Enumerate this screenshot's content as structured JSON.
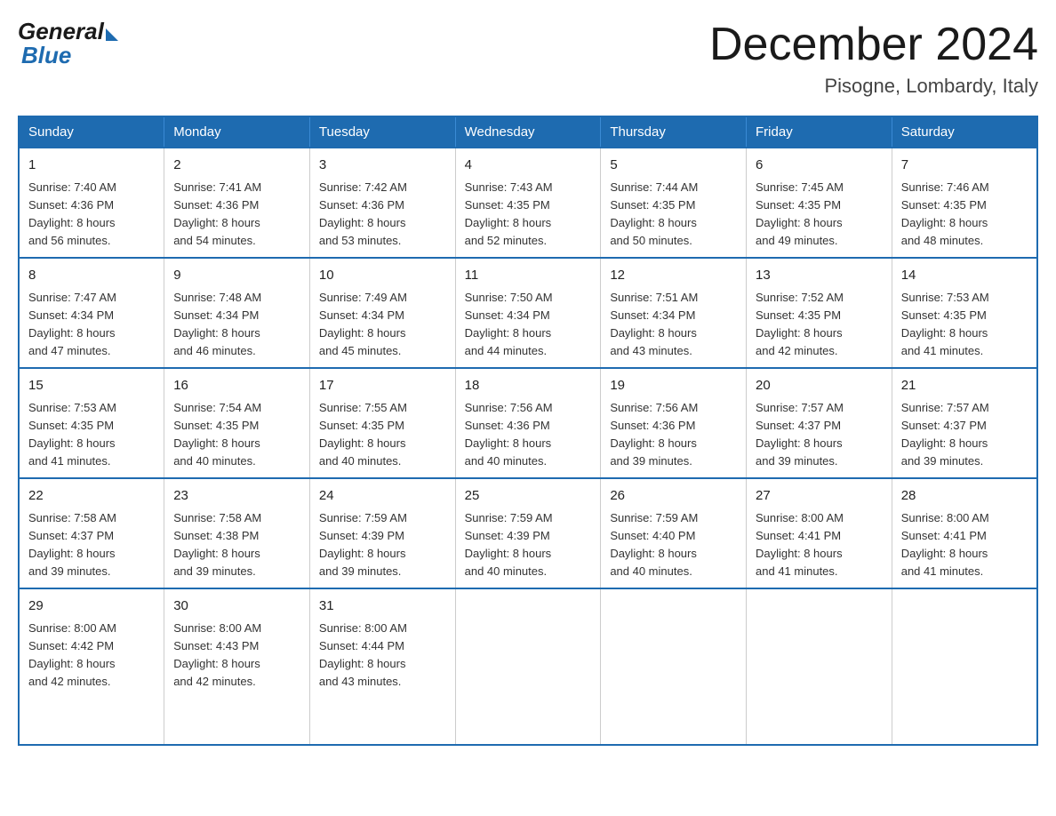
{
  "logo": {
    "general": "General",
    "blue": "Blue"
  },
  "title": "December 2024",
  "location": "Pisogne, Lombardy, Italy",
  "days_of_week": [
    "Sunday",
    "Monday",
    "Tuesday",
    "Wednesday",
    "Thursday",
    "Friday",
    "Saturday"
  ],
  "weeks": [
    [
      {
        "day": "1",
        "sunrise": "7:40 AM",
        "sunset": "4:36 PM",
        "daylight": "8 hours and 56 minutes."
      },
      {
        "day": "2",
        "sunrise": "7:41 AM",
        "sunset": "4:36 PM",
        "daylight": "8 hours and 54 minutes."
      },
      {
        "day": "3",
        "sunrise": "7:42 AM",
        "sunset": "4:36 PM",
        "daylight": "8 hours and 53 minutes."
      },
      {
        "day": "4",
        "sunrise": "7:43 AM",
        "sunset": "4:35 PM",
        "daylight": "8 hours and 52 minutes."
      },
      {
        "day": "5",
        "sunrise": "7:44 AM",
        "sunset": "4:35 PM",
        "daylight": "8 hours and 50 minutes."
      },
      {
        "day": "6",
        "sunrise": "7:45 AM",
        "sunset": "4:35 PM",
        "daylight": "8 hours and 49 minutes."
      },
      {
        "day": "7",
        "sunrise": "7:46 AM",
        "sunset": "4:35 PM",
        "daylight": "8 hours and 48 minutes."
      }
    ],
    [
      {
        "day": "8",
        "sunrise": "7:47 AM",
        "sunset": "4:34 PM",
        "daylight": "8 hours and 47 minutes."
      },
      {
        "day": "9",
        "sunrise": "7:48 AM",
        "sunset": "4:34 PM",
        "daylight": "8 hours and 46 minutes."
      },
      {
        "day": "10",
        "sunrise": "7:49 AM",
        "sunset": "4:34 PM",
        "daylight": "8 hours and 45 minutes."
      },
      {
        "day": "11",
        "sunrise": "7:50 AM",
        "sunset": "4:34 PM",
        "daylight": "8 hours and 44 minutes."
      },
      {
        "day": "12",
        "sunrise": "7:51 AM",
        "sunset": "4:34 PM",
        "daylight": "8 hours and 43 minutes."
      },
      {
        "day": "13",
        "sunrise": "7:52 AM",
        "sunset": "4:35 PM",
        "daylight": "8 hours and 42 minutes."
      },
      {
        "day": "14",
        "sunrise": "7:53 AM",
        "sunset": "4:35 PM",
        "daylight": "8 hours and 41 minutes."
      }
    ],
    [
      {
        "day": "15",
        "sunrise": "7:53 AM",
        "sunset": "4:35 PM",
        "daylight": "8 hours and 41 minutes."
      },
      {
        "day": "16",
        "sunrise": "7:54 AM",
        "sunset": "4:35 PM",
        "daylight": "8 hours and 40 minutes."
      },
      {
        "day": "17",
        "sunrise": "7:55 AM",
        "sunset": "4:35 PM",
        "daylight": "8 hours and 40 minutes."
      },
      {
        "day": "18",
        "sunrise": "7:56 AM",
        "sunset": "4:36 PM",
        "daylight": "8 hours and 40 minutes."
      },
      {
        "day": "19",
        "sunrise": "7:56 AM",
        "sunset": "4:36 PM",
        "daylight": "8 hours and 39 minutes."
      },
      {
        "day": "20",
        "sunrise": "7:57 AM",
        "sunset": "4:37 PM",
        "daylight": "8 hours and 39 minutes."
      },
      {
        "day": "21",
        "sunrise": "7:57 AM",
        "sunset": "4:37 PM",
        "daylight": "8 hours and 39 minutes."
      }
    ],
    [
      {
        "day": "22",
        "sunrise": "7:58 AM",
        "sunset": "4:37 PM",
        "daylight": "8 hours and 39 minutes."
      },
      {
        "day": "23",
        "sunrise": "7:58 AM",
        "sunset": "4:38 PM",
        "daylight": "8 hours and 39 minutes."
      },
      {
        "day": "24",
        "sunrise": "7:59 AM",
        "sunset": "4:39 PM",
        "daylight": "8 hours and 39 minutes."
      },
      {
        "day": "25",
        "sunrise": "7:59 AM",
        "sunset": "4:39 PM",
        "daylight": "8 hours and 40 minutes."
      },
      {
        "day": "26",
        "sunrise": "7:59 AM",
        "sunset": "4:40 PM",
        "daylight": "8 hours and 40 minutes."
      },
      {
        "day": "27",
        "sunrise": "8:00 AM",
        "sunset": "4:41 PM",
        "daylight": "8 hours and 41 minutes."
      },
      {
        "day": "28",
        "sunrise": "8:00 AM",
        "sunset": "4:41 PM",
        "daylight": "8 hours and 41 minutes."
      }
    ],
    [
      {
        "day": "29",
        "sunrise": "8:00 AM",
        "sunset": "4:42 PM",
        "daylight": "8 hours and 42 minutes."
      },
      {
        "day": "30",
        "sunrise": "8:00 AM",
        "sunset": "4:43 PM",
        "daylight": "8 hours and 42 minutes."
      },
      {
        "day": "31",
        "sunrise": "8:00 AM",
        "sunset": "4:44 PM",
        "daylight": "8 hours and 43 minutes."
      },
      null,
      null,
      null,
      null
    ]
  ],
  "labels": {
    "sunrise": "Sunrise:",
    "sunset": "Sunset:",
    "daylight": "Daylight:"
  }
}
